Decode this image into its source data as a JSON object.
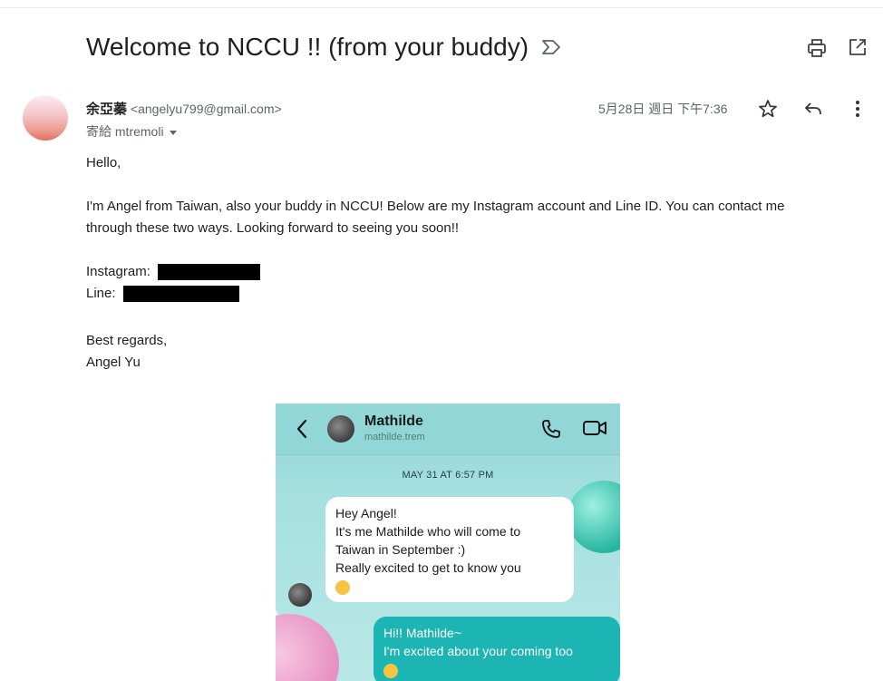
{
  "email": {
    "subject": "Welcome to NCCU !! (from your buddy)",
    "sender_name": "余亞蓁",
    "sender_email": "<angelyu799@gmail.com>",
    "recipient": "寄給 mtremoli",
    "date": "5月28日 週日 下午7:36",
    "greeting": "Hello,",
    "para1_line1": "I'm Angel from Taiwan, also your buddy in NCCU! Below are my Instagram account and Line ID. You can contact me",
    "para1_line2": "through these two ways. Looking forward to seeing you soon!!",
    "instagram_label": "Instagram:",
    "line_label": "Line:",
    "closing": "Best regards,",
    "signature": "Angel Yu"
  },
  "icons": {
    "important": "importance-marker-icon",
    "print": "print-icon",
    "open_new_window": "open-in-new-window-icon",
    "star": "star-icon",
    "reply": "reply-icon",
    "more": "more-vert-icon"
  },
  "chat": {
    "contact_name": "Mathilde",
    "contact_handle": "mathilde.trem",
    "timestamp": "MAY 31 AT 6:57 PM",
    "incoming": [
      "Hey Angel!",
      "It's me Mathilde who will come to",
      "Taiwan in September :)",
      "Really excited to get to know you"
    ],
    "outgoing": [
      "Hi!! Mathilde~",
      "I'm excited about your coming too"
    ]
  },
  "colors": {
    "chat_background": "#a4dfe0",
    "outgoing_bubble": "#1cb5b3",
    "incoming_bubble": "#ffffff"
  }
}
